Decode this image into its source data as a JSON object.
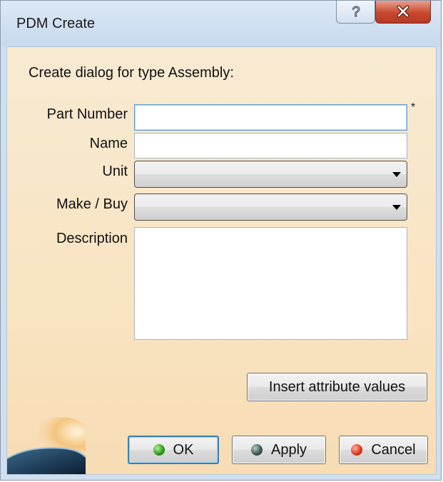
{
  "window": {
    "title": "PDM Create",
    "help_glyph": "?",
    "close_glyph": "x"
  },
  "dialog": {
    "heading": "Create dialog for type Assembly:",
    "required_marker": "*",
    "fields": {
      "part_number": {
        "label": "Part Number",
        "value": ""
      },
      "name": {
        "label": "Name",
        "value": ""
      },
      "unit": {
        "label": "Unit",
        "selected": ""
      },
      "make_buy": {
        "label": "Make / Buy",
        "selected": ""
      },
      "description": {
        "label": "Description",
        "value": ""
      }
    },
    "insert_button": "Insert attribute values"
  },
  "buttons": {
    "ok": "OK",
    "apply": "Apply",
    "cancel": "Cancel"
  },
  "icons": {
    "ok": "green-ball-icon",
    "apply": "dark-ball-icon",
    "cancel": "red-ball-icon"
  },
  "colors": {
    "dialog_background": "#f9e4c2",
    "focus_border": "#5b9bd5",
    "close_button": "#c9482f"
  }
}
